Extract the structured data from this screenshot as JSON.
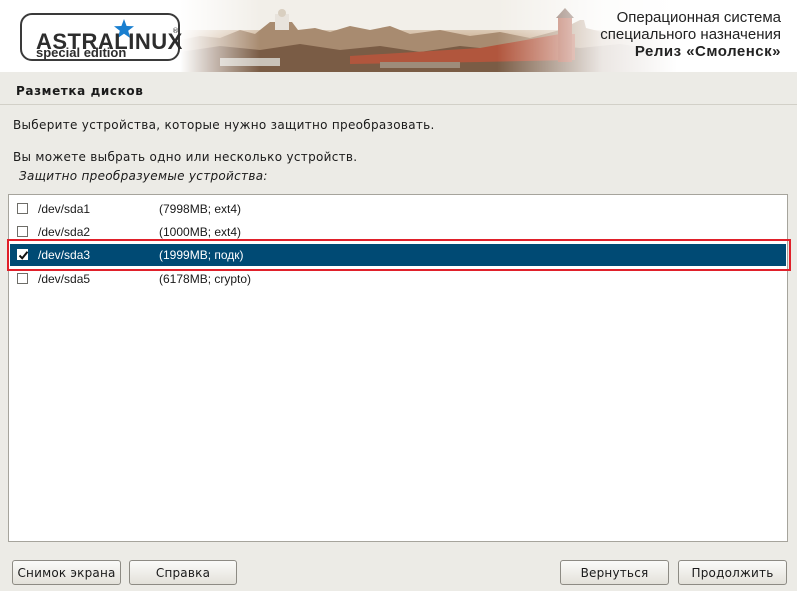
{
  "header": {
    "logo_main": "ASTRALINUX",
    "logo_reg": "®",
    "logo_sub": "special edition",
    "release_line1": "Операционная система",
    "release_line2": "специального назначения",
    "release_line3": "Релиз «Смоленск»"
  },
  "page": {
    "title": "Разметка дисков",
    "instruction": "Выберите устройства, которые нужно защитно преобразовать.",
    "hint": "Вы можете выбрать одно или несколько устройств.",
    "list_caption": "Защитно преобразуемые устройства:"
  },
  "devices": [
    {
      "device": "/dev/sda1",
      "info": "(7998MB; ext4)",
      "checked": false
    },
    {
      "device": "/dev/sda2",
      "info": "(1000MB; ext4)",
      "checked": false
    },
    {
      "device": "/dev/sda3",
      "info": "(1999MB; подк)",
      "checked": true
    },
    {
      "device": "/dev/sda5",
      "info": "(6178MB; crypto)",
      "checked": false
    }
  ],
  "buttons": {
    "screenshot": "Снимок экрана",
    "help": "Справка",
    "back": "Вернуться",
    "continue": "Продолжить"
  },
  "colors": {
    "selection": "#004a74",
    "highlight_frame": "#e0202a",
    "logo_star": "#1a7fd0"
  },
  "icons": {
    "logo": "star-icon",
    "checkbox_checked": "checkmark-icon"
  }
}
